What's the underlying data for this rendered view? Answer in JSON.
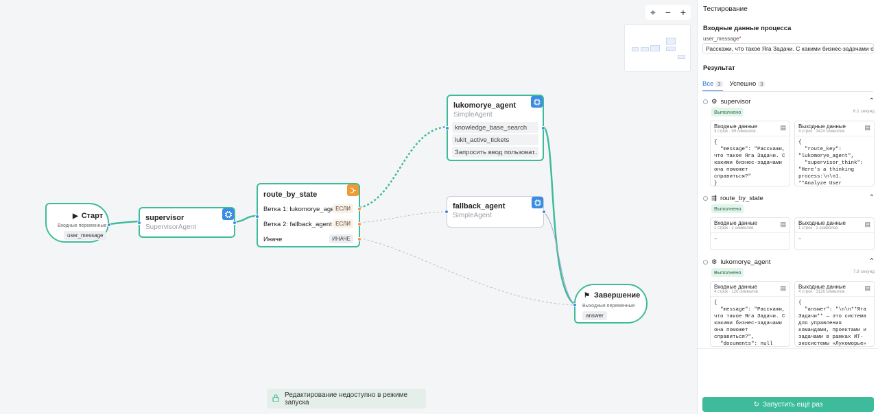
{
  "canvas": {
    "zoom_controls": {
      "focus": "⌖",
      "minus": "−",
      "plus": "+"
    },
    "start_node": {
      "title": "Старт",
      "subtitle": "Входные переменные",
      "variable": "user_message"
    },
    "supervisor_node": {
      "title": "supervisor",
      "type": "SupervisorAgent"
    },
    "route_node": {
      "title": "route_by_state",
      "branches": [
        {
          "label": "Ветка 1: lukomorye_agent",
          "tag": "ЕСЛИ"
        },
        {
          "label": "Ветка 2: fallback_agent",
          "tag": "ЕСЛИ"
        },
        {
          "label": "Иначе",
          "tag": "ИНАЧЕ"
        }
      ]
    },
    "lukomorye_node": {
      "title": "lukomorye_agent",
      "type": "SimpleAgent",
      "tools": [
        "knowledge_base_search",
        "lukit_active_tickets",
        "Запросить ввод пользоват..."
      ]
    },
    "fallback_node": {
      "title": "fallback_agent",
      "type": "SimpleAgent"
    },
    "end_node": {
      "title": "Завершение",
      "subtitle": "Выходные переменные",
      "variable": "answer"
    },
    "lock_message": "Редактирование недоступно в режиме запуска",
    "colors": {
      "active_edge": "#3dbb9b",
      "agent_badge": "#3b8de3",
      "router_badge": "#f09a33"
    }
  },
  "panel": {
    "title": "Тестирование",
    "input_section": "Входные данные процесса",
    "field_label": "user_message",
    "field_required": "*",
    "field_value": "Расскажи, что такое Яга Задачи. С какими бизнес-задачами она ...",
    "result_title": "Результат",
    "tabs": [
      {
        "label": "Все",
        "count": "3"
      },
      {
        "label": "Успешно",
        "count": "3"
      }
    ],
    "results": [
      {
        "name": "supervisor",
        "status": "Выполнено",
        "time": "6.1 секунд",
        "input_title": "Входные данные",
        "input_meta": "3 строк · 99 символов",
        "input_body": "{\n  \"message\": \"Расскажи, что такое Яга Задачи. С какими бизнес-задачами она поможет справиться?\"\n}",
        "output_title": "Выходные данные",
        "output_meta": "4 строк · 3424 символов",
        "output_body": "{\n  \"route_key\": \"lukomorye_agent\",\n  \"supervisor_think\": \"Here's a thinking process:\\n\\n1. **Analyze User"
      },
      {
        "name": "route_by_state",
        "status": "Выполнено",
        "time": "",
        "input_title": "Входные данные",
        "input_meta": "1 строк · 1 символов",
        "input_body": "–",
        "output_title": "Выходные данные",
        "output_meta": "1 строк · 1 символов",
        "output_body": "–"
      },
      {
        "name": "lukomorye_agent",
        "status": "Выполнено",
        "time": "7.9 секунд",
        "input_title": "Входные данные",
        "input_meta": "4 строк · 120 символов",
        "input_body": "{\n  \"message\": \"Расскажи, что такое Яга Задачи. С какими бизнес-задачами она поможет справиться?\",\n  \"documents\": null",
        "output_title": "Выходные данные",
        "output_meta": "4 строк · 3126 символов",
        "output_body": "{\n  \"answer\": \"\\n\\n**Яга Задачи** — это система для управления командами, проектами и задачами в рамках ИТ-экосистемы «Лукоморье»"
      }
    ],
    "run_button": "Запустить ещё раз"
  }
}
